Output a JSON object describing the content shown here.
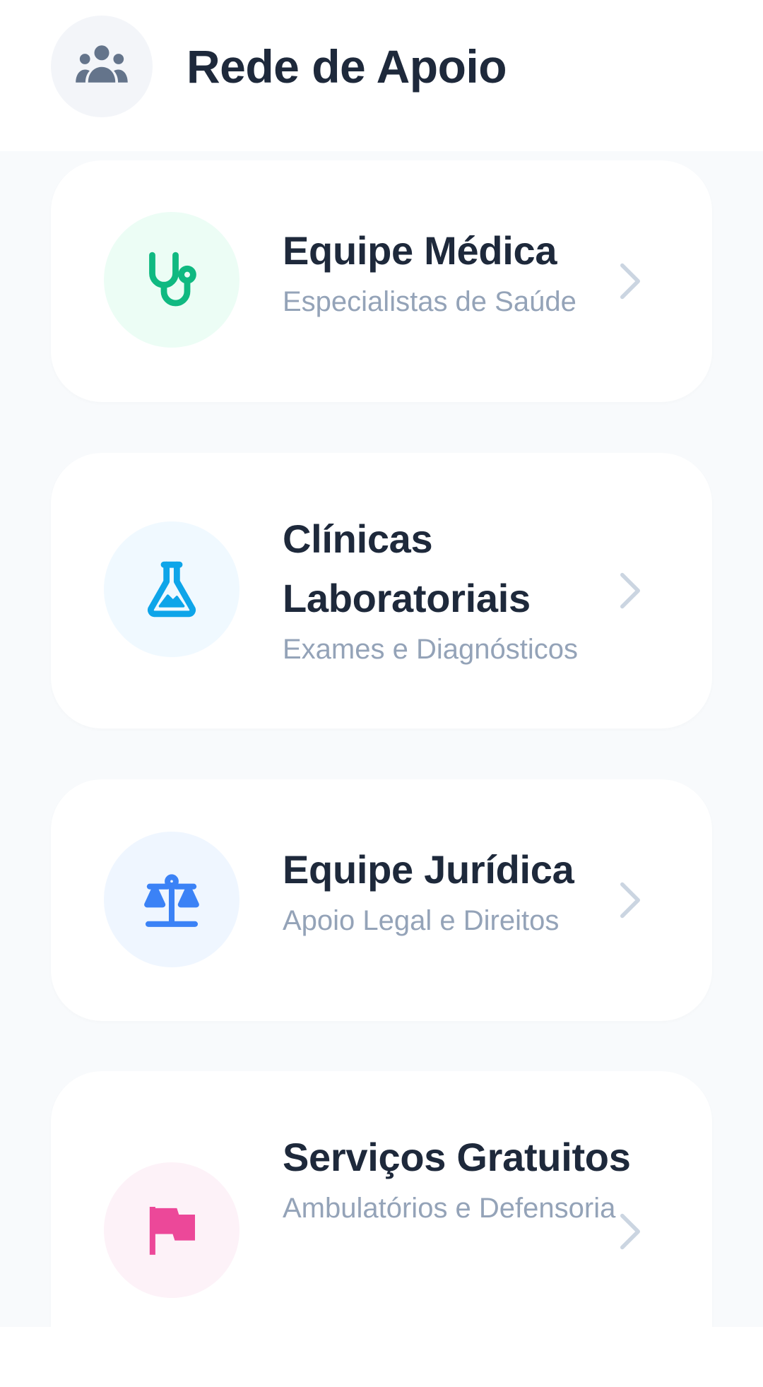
{
  "header": {
    "title": "Rede de Apoio",
    "icon": "users-group-icon"
  },
  "cards": [
    {
      "title": "Equipe Médica",
      "subtitle": "Especialistas de Saúde",
      "icon": "stethoscope-icon",
      "icon_color": "#10b981",
      "icon_bg": "#ecfdf5"
    },
    {
      "title": "Clínicas Laboratoriais",
      "subtitle": "Exames e Diagnósticos",
      "icon": "flask-icon",
      "icon_color": "#0ea5e9",
      "icon_bg": "#f0f9ff"
    },
    {
      "title": "Equipe Jurídica",
      "subtitle": "Apoio Legal e Direitos",
      "icon": "scale-icon",
      "icon_color": "#3b82f6",
      "icon_bg": "#eff6ff"
    },
    {
      "title": "Serviços Gratuitos",
      "subtitle": "Ambulatórios e Defensoria",
      "icon": "flag-icon",
      "icon_color": "#ec4899",
      "icon_bg": "#fdf2f8"
    }
  ],
  "colors": {
    "text_primary": "#1e293b",
    "text_secondary": "#94a3b8",
    "chevron": "#cbd5e1",
    "list_background": "#f8fafc"
  }
}
